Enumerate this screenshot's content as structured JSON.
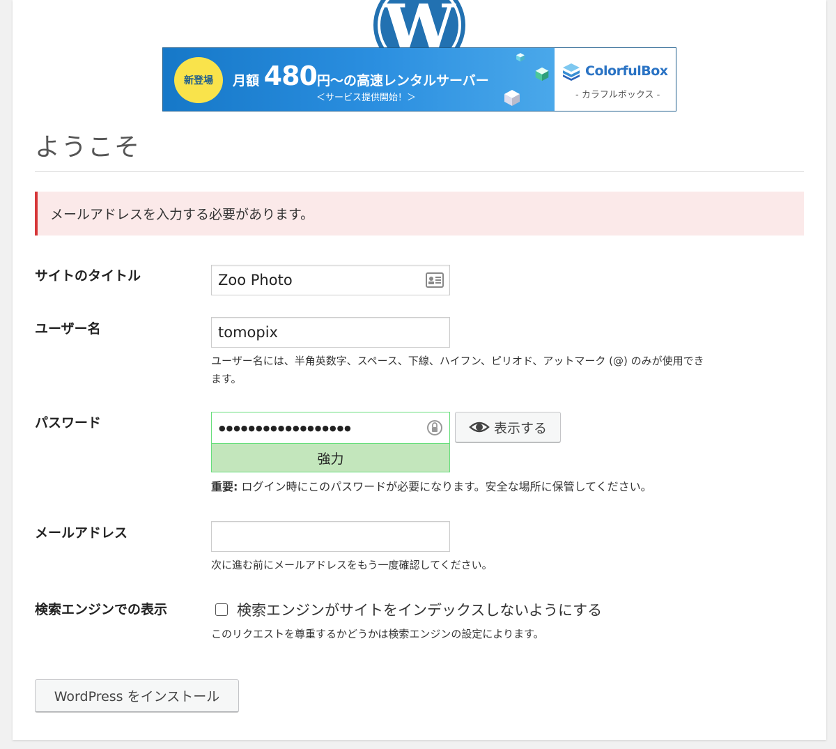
{
  "banner": {
    "badge": "新登場",
    "price_prefix": "月額",
    "price_amount": "480",
    "price_suffix": "円～の高速レンタルサーバー",
    "service_note": "＜サービス提供開始！＞",
    "brand_name": "ColorfulBox",
    "brand_sub": "- カラフルボックス -"
  },
  "page": {
    "title": "ようこそ",
    "error_notice": "メールアドレスを入力する必要があります。"
  },
  "form": {
    "site_title": {
      "label": "サイトのタイトル",
      "value": "Zoo Photo"
    },
    "username": {
      "label": "ユーザー名",
      "value": "tomopix",
      "help_line1": "ユーザー名には、半角英数字、スペース、下線、ハイフン、ピリオド、アットマーク (@) のみが使用でき",
      "help_line2": "ます。"
    },
    "password": {
      "label": "パスワード",
      "masked_value": "●●●●●●●●●●●●●●●●●●",
      "strength": "強力",
      "toggle_label": "表示する",
      "important_label": "重要:",
      "important_text": " ログイン時にこのパスワードが必要になります。安全な場所に保管してください。"
    },
    "email": {
      "label": "メールアドレス",
      "value": "",
      "help": "次に進む前にメールアドレスをもう一度確認してください。"
    },
    "search_visibility": {
      "label": "検索エンジンでの表示",
      "checkbox_label": "検索エンジンがサイトをインデックスしないようにする",
      "checked": false,
      "help": "このリクエストを尊重するかどうかは検索エンジンの設定によります。"
    },
    "submit_label": "WordPress をインストール"
  },
  "colors": {
    "wp_blue": "#2271b1",
    "error_red": "#d63638",
    "error_bg": "#fbe9e9",
    "strong_green": "#c3e6bc",
    "banner_blue": "#1678c8",
    "badge_yellow": "#f9e34b"
  }
}
